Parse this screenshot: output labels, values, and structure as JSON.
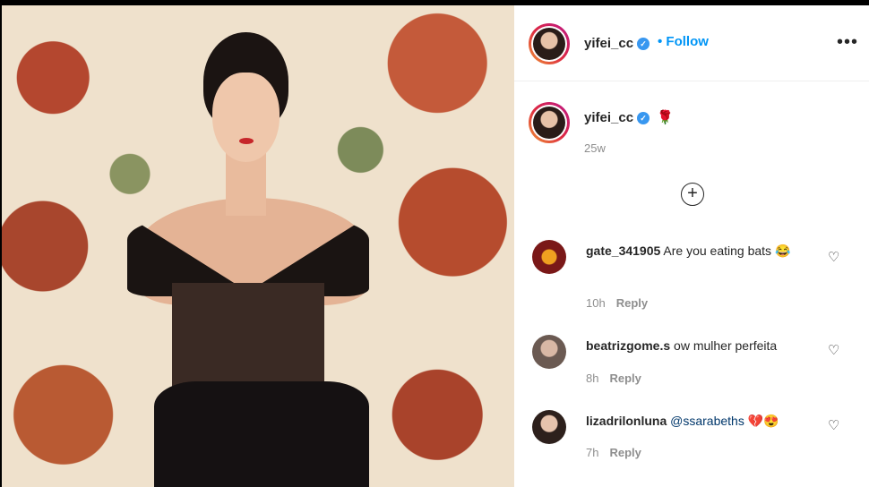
{
  "post": {
    "username": "yifei_cc",
    "follow_label": "Follow",
    "caption_emoji": "🌹",
    "age": "25w"
  },
  "comments": [
    {
      "user": "gate_341905",
      "text": "Are you eating bats 😂",
      "time": "10h",
      "reply": "Reply"
    },
    {
      "user": "beatrizgome.s",
      "text": "ow mulher perfeita",
      "time": "8h",
      "reply": "Reply"
    },
    {
      "user": "lizadrilonluna",
      "mention": "@ssarabeths",
      "emoji": "💔😍",
      "time": "7h",
      "reply": "Reply"
    }
  ],
  "colors": {
    "follow": "#0095f6",
    "verified": "#3897f0"
  }
}
